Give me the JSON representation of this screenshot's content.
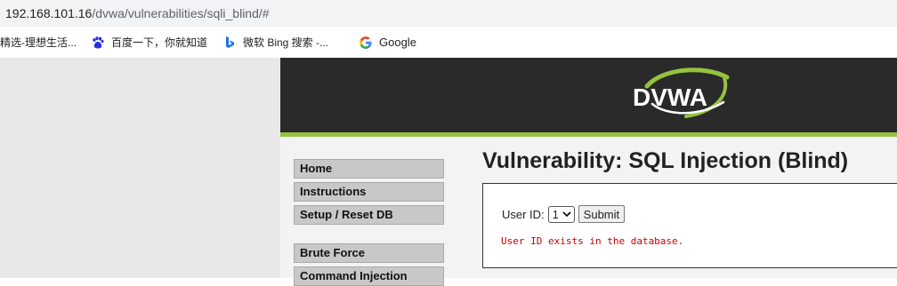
{
  "browser": {
    "url_host": "192.168.101.16",
    "url_path": "/dvwa/vulnerabilities/sqli_blind/#",
    "bookmarks": [
      {
        "label": "精选-理想生活..."
      },
      {
        "label": "百度一下，你就知道",
        "icon": "baidu-icon"
      },
      {
        "label": "微软 Bing 搜索 -...",
        "icon": "bing-icon"
      },
      {
        "label": "Google",
        "icon": "google-icon"
      }
    ]
  },
  "header": {
    "logo_text": "DVWA",
    "accent_color": "#95c23f"
  },
  "menu": {
    "items": [
      {
        "label": "Home"
      },
      {
        "label": "Instructions"
      },
      {
        "label": "Setup / Reset DB"
      },
      {
        "label": "Brute Force"
      },
      {
        "label": "Command Injection"
      }
    ]
  },
  "main": {
    "title": "Vulnerability: SQL Injection (Blind)",
    "form": {
      "label": "User ID:",
      "selected_value": "1",
      "submit_label": "Submit"
    },
    "message": "User ID exists in the database."
  }
}
